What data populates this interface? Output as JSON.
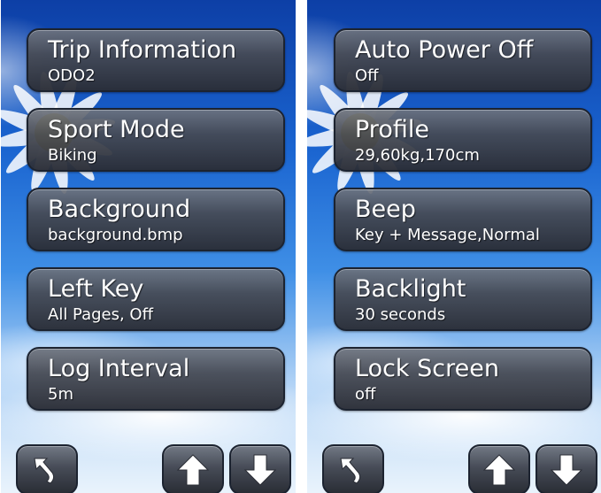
{
  "left_screen": {
    "items": [
      {
        "title": "Trip Information",
        "value": "ODO2"
      },
      {
        "title": "Sport Mode",
        "value": "Biking"
      },
      {
        "title": "Background",
        "value": "background.bmp"
      },
      {
        "title": "Left Key",
        "value": "All Pages, Off"
      },
      {
        "title": "Log Interval",
        "value": "5m"
      }
    ]
  },
  "right_screen": {
    "items": [
      {
        "title": "Auto Power Off",
        "value": "Off"
      },
      {
        "title": "Profile",
        "value": "29,60kg,170cm"
      },
      {
        "title": "Beep",
        "value": "Key + Message,Normal"
      },
      {
        "title": "Backlight",
        "value": "30 seconds"
      },
      {
        "title": "Lock Screen",
        "value": "off"
      }
    ]
  },
  "nav": {
    "back_icon": "back-arrow-icon",
    "up_icon": "arrow-up-icon",
    "down_icon": "arrow-down-icon"
  },
  "colors": {
    "card": "#484c57",
    "card_border": "#1c2330",
    "text": "#ffffff",
    "sky_top": "#0d3fa6",
    "sky_bottom": "#e9f3fc"
  }
}
